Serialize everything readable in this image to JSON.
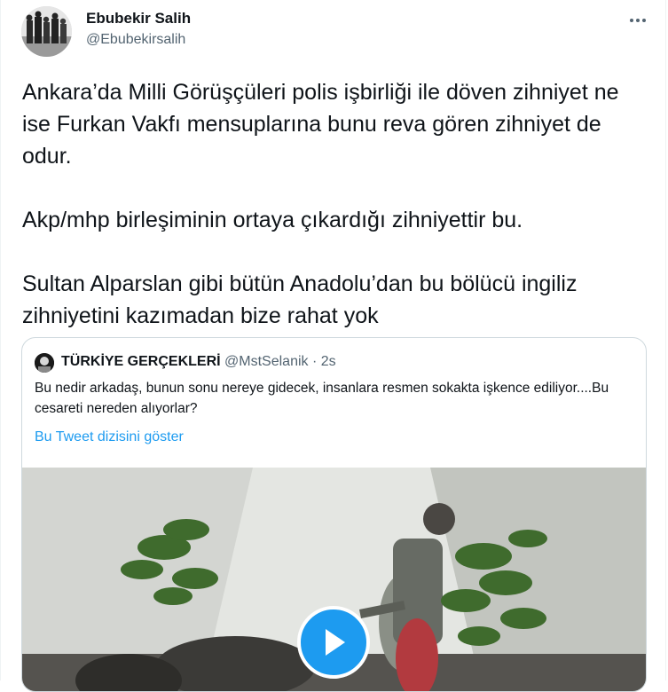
{
  "author": {
    "name": "Ebubekir Salih",
    "handle": "@Ebubekirsalih"
  },
  "tweet": {
    "paragraphs": [
      "Ankara’da Milli Görüşçüleri polis işbirliği ile döven zihniyet ne ise Furkan Vakfı mensuplarına bunu reva gören zihniyet de odur.",
      "Akp/mhp birleşiminin ortaya çıkardığı zihniyettir bu.",
      "Sultan Alparslan gibi bütün Anadolu’dan bu bölücü ingiliz zihniyetini kazımadan bize rahat yok"
    ]
  },
  "quoted_tweet": {
    "name": "TÜRKİYE GERÇEKLERİ",
    "handle": "@MstSelanik",
    "separator": "·",
    "time": "2s",
    "text": "Bu nedir arkadaş, bunun sonu nereye gidecek, insanlara resmen sokakta işkence ediliyor....Bu cesareti nereden alıyorlar?",
    "thread_link": "Bu Tweet dizisini göster"
  },
  "icons": {
    "more": "more-dots-icon",
    "play": "play-icon"
  },
  "colors": {
    "accent": "#1d9bf0",
    "text": "#0f1419",
    "secondary": "#536471",
    "border": "#cfd9de"
  }
}
